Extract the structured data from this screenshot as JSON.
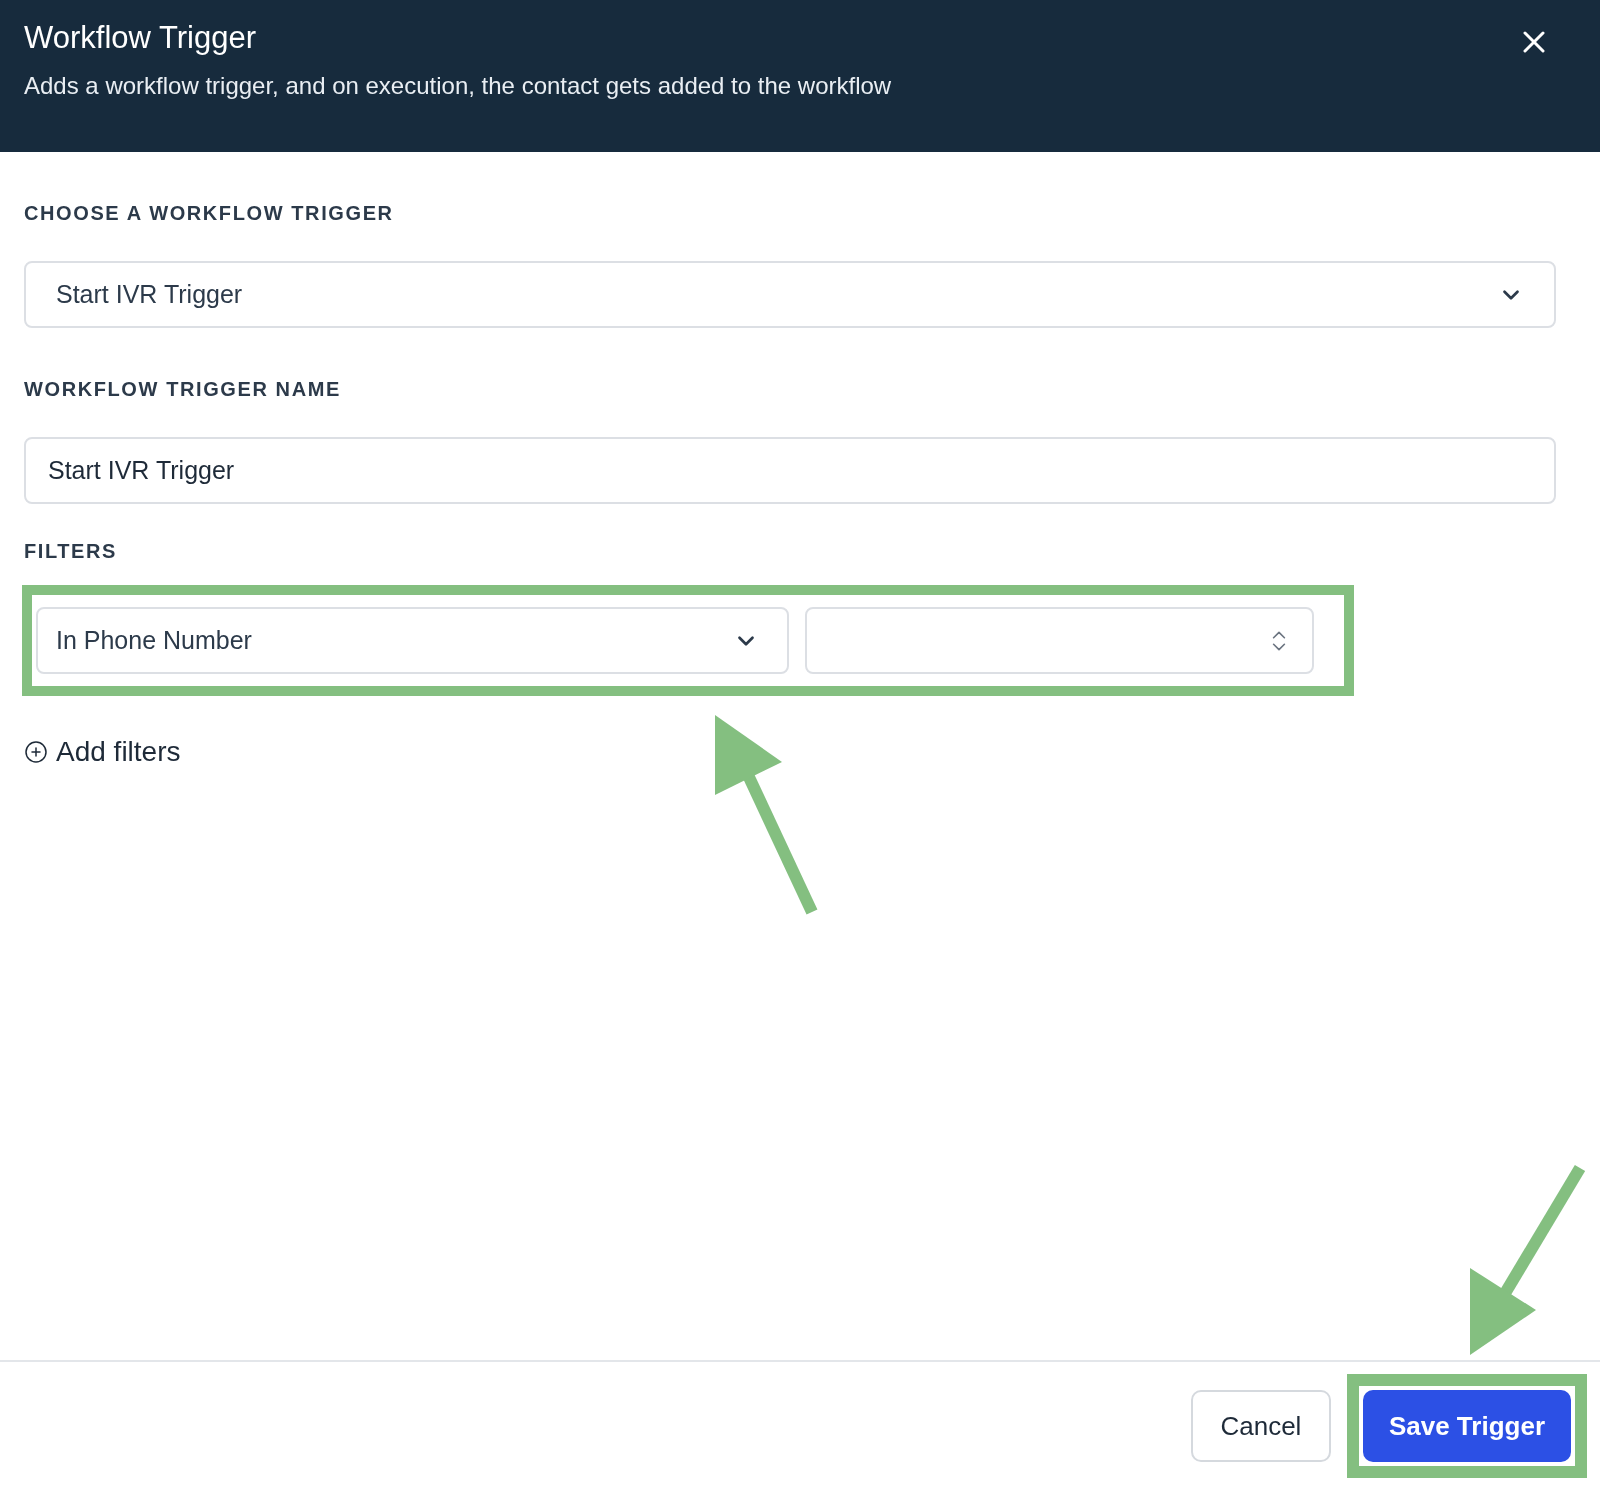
{
  "dialog": {
    "title": "Workflow Trigger",
    "subtitle": "Adds a workflow trigger, and on execution, the contact gets added to the workflow"
  },
  "trigger_select": {
    "label": "CHOOSE A WORKFLOW TRIGGER",
    "value": "Start IVR Trigger"
  },
  "trigger_name": {
    "label": "WORKFLOW TRIGGER NAME",
    "value": "Start IVR Trigger"
  },
  "filters": {
    "label": "FILTERS",
    "rows": [
      {
        "field": "In Phone Number"
      }
    ],
    "add_label": "Add filters"
  },
  "buttons": {
    "cancel": "Cancel",
    "save": "Save Trigger"
  }
}
